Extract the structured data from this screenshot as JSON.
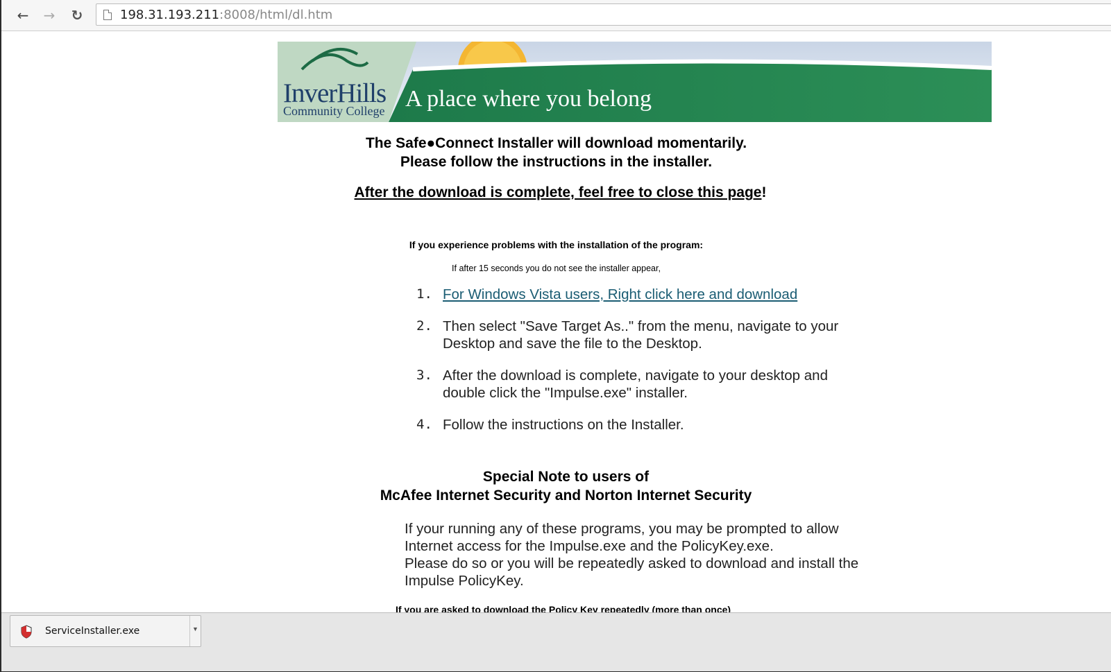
{
  "browser": {
    "url_host": "198.31.193.211",
    "url_rest": ":8008/html/dl.htm"
  },
  "banner": {
    "logo_main": "InverHills",
    "logo_sub": "Community College",
    "tagline": "A place where you belong"
  },
  "page": {
    "heading_line1": "The Safe●Connect Installer will download momentarily.",
    "heading_line2": "Please follow the instructions in the installer.",
    "close_text": "After the download is complete, feel free to close this page",
    "close_exclaim": "!",
    "problems_heading": "If you experience problems with the installation of the program:",
    "problems_sub": "If after 15 seconds you do not see the installer appear,",
    "steps": [
      {
        "num": "1.",
        "text": "For Windows Vista users, Right click here and download"
      },
      {
        "num": "2.",
        "text": "Then select \"Save Target As..\" from the menu, navigate to your Desktop and save the file to the Desktop."
      },
      {
        "num": "3.",
        "text": "After the download is complete, navigate to your desktop and double click the \"Impulse.exe\" installer."
      },
      {
        "num": "4.",
        "text": "Follow the instructions on the Installer."
      }
    ],
    "note_line1": "Special Note to users of",
    "note_line2": "McAfee Internet Security and Norton Internet Security",
    "para_1": "If your running any of these programs, you may be prompted to allow Internet access for the Impulse.exe and the PolicyKey.exe.",
    "para_2": "Please do so or you will be repeatedly asked to download and install the Impulse PolicyKey.",
    "cutoff": "If you are asked to download the Policy Key repeatedly (more than once)"
  },
  "download_shelf": {
    "filename": "ServiceInstaller.exe"
  }
}
